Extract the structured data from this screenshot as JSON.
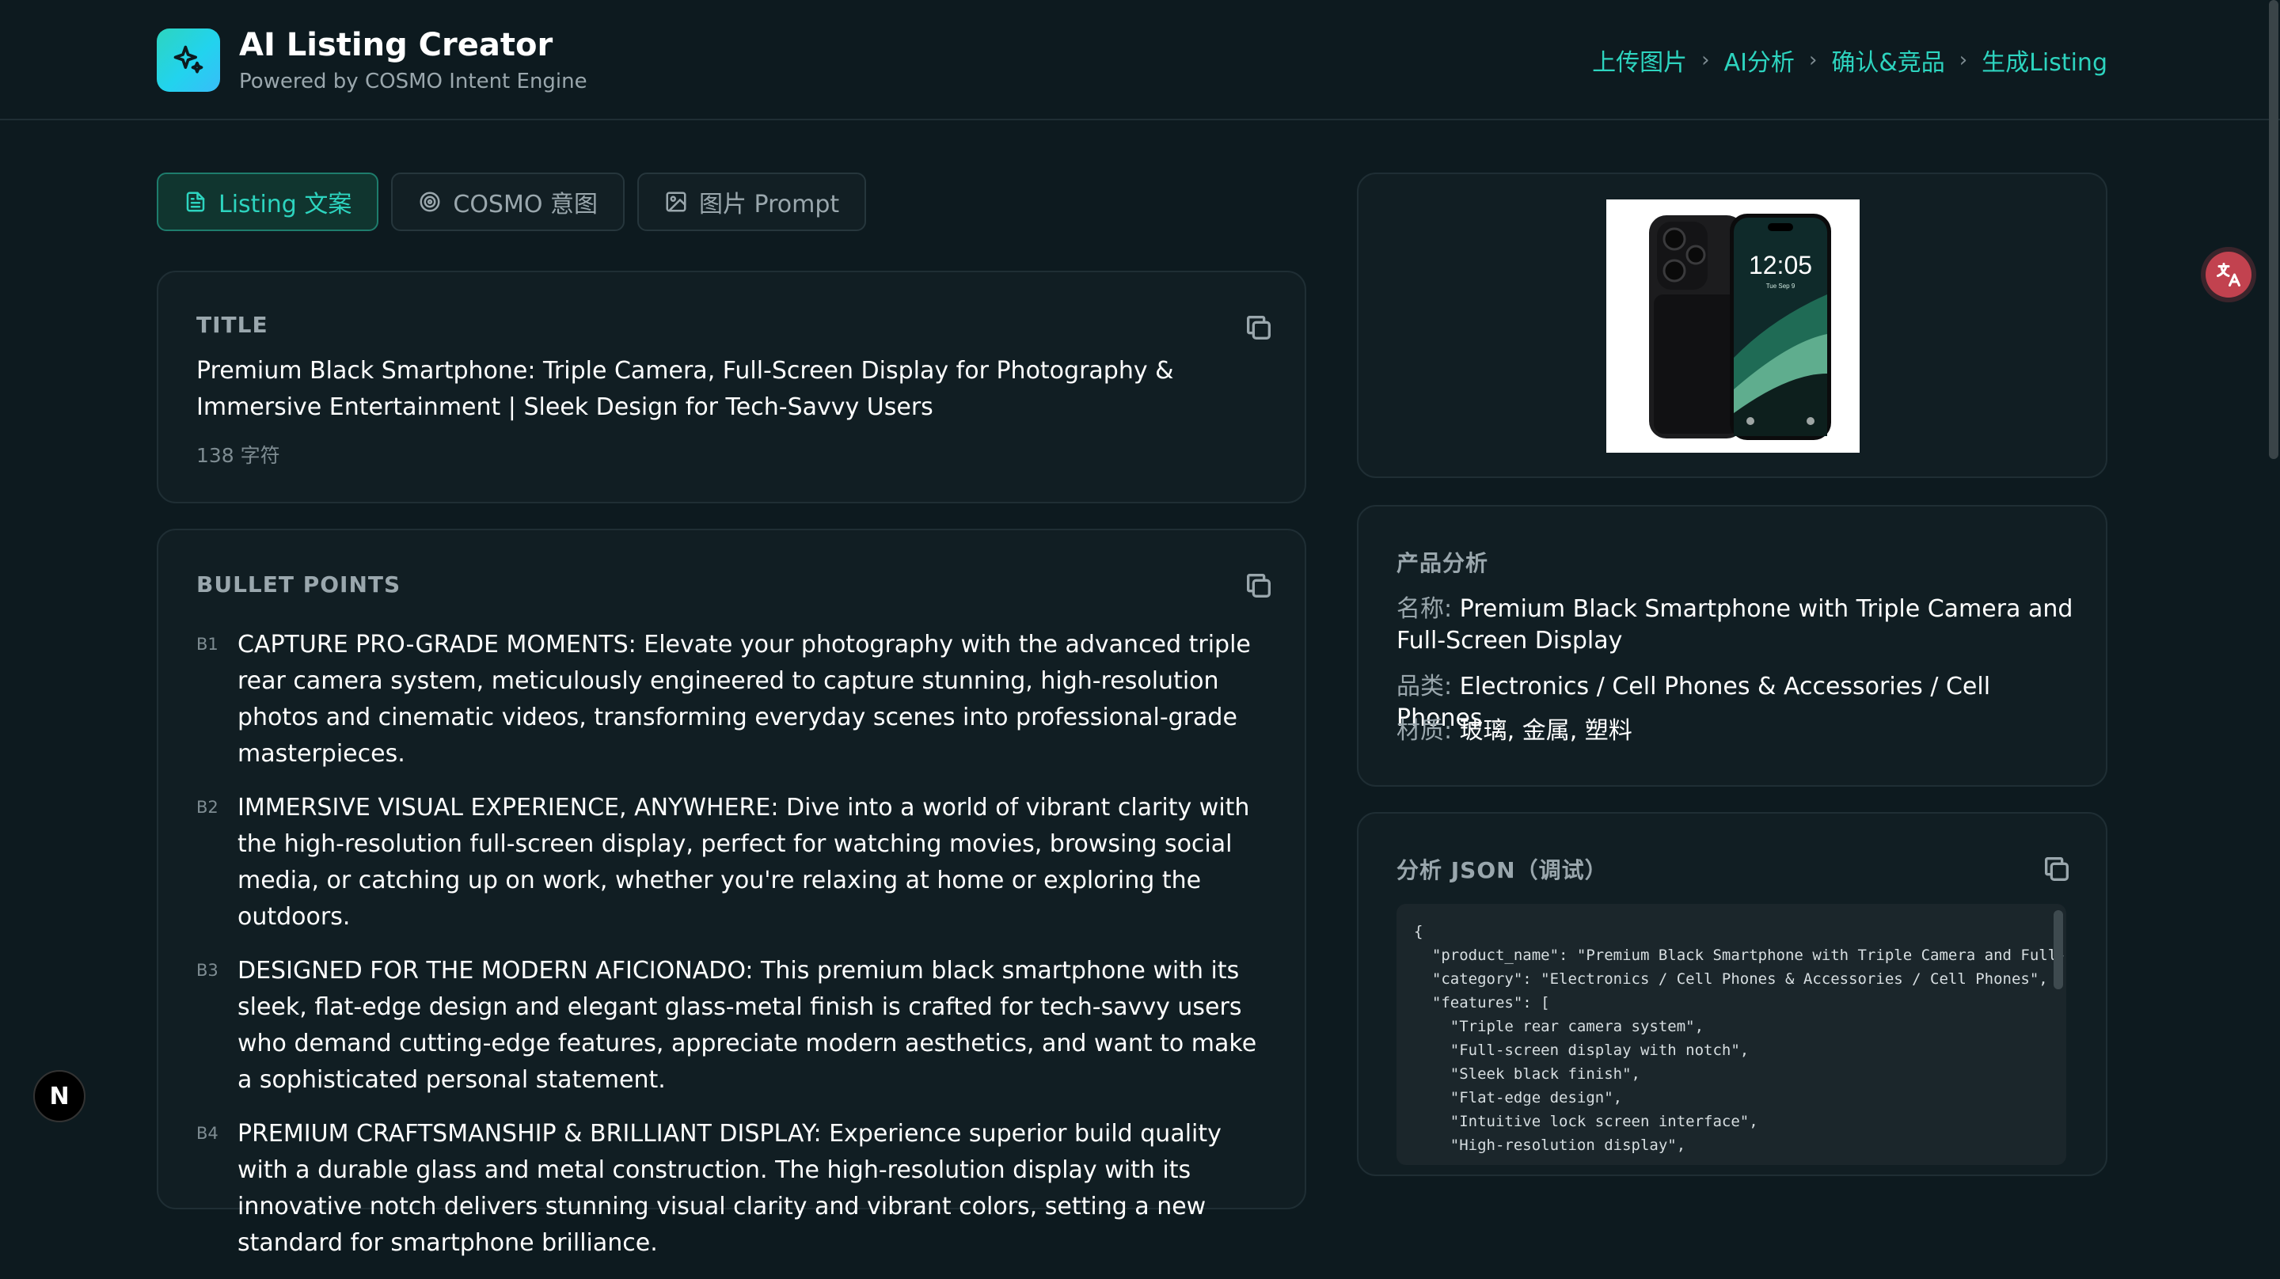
{
  "header": {
    "title": "AI Listing Creator",
    "subtitle": "Powered by COSMO Intent Engine",
    "steps": [
      "上传图片",
      "AI分析",
      "确认&竞品",
      "生成Listing"
    ]
  },
  "tabs": [
    {
      "label": "Listing 文案",
      "active": true
    },
    {
      "label": "COSMO 意图",
      "active": false
    },
    {
      "label": "图片 Prompt",
      "active": false
    }
  ],
  "title_card": {
    "label": "TITLE",
    "text": "Premium Black Smartphone: Triple Camera, Full-Screen Display for Photography & Immersive Entertainment | Sleek Design for Tech-Savvy Users",
    "char_count": "138 字符"
  },
  "bullets_card": {
    "label": "BULLET POINTS",
    "items": [
      {
        "tag": "B1",
        "text": "CAPTURE PRO-GRADE MOMENTS: Elevate your photography with the advanced triple rear camera system, meticulously engineered to capture stunning, high-resolution photos and cinematic videos, transforming everyday scenes into professional-grade masterpieces."
      },
      {
        "tag": "B2",
        "text": "IMMERSIVE VISUAL EXPERIENCE, ANYWHERE: Dive into a world of vibrant clarity with the high-resolution full-screen display, perfect for watching movies, browsing social media, or catching up on work, whether you're relaxing at home or exploring the outdoors."
      },
      {
        "tag": "B3",
        "text": "DESIGNED FOR THE MODERN AFICIONADO: This premium black smartphone with its sleek, flat-edge design and elegant glass-metal finish is crafted for tech-savvy users who demand cutting-edge features, appreciate modern aesthetics, and want to make a sophisticated personal statement."
      },
      {
        "tag": "B4",
        "text": "PREMIUM CRAFTSMANSHIP & BRILLIANT DISPLAY: Experience superior build quality with a durable glass and metal construction. The high-resolution display with its innovative notch delivers stunning visual clarity and vibrant colors, setting a new standard for smartphone brilliance."
      }
    ]
  },
  "product_image": {
    "clock": "12:05",
    "date": "Tue Sep 9"
  },
  "analysis_card": {
    "label": "产品分析",
    "name_key": "名称:",
    "name_value": "Premium Black Smartphone with Triple Camera and Full-Screen Display",
    "category_key": "品类:",
    "category_value": "Electronics / Cell Phones & Accessories / Cell Phones",
    "material_key": "材质:",
    "material_value": "玻璃, 金属, 塑料"
  },
  "json_card": {
    "label": "分析 JSON（调试）",
    "content": "{\n  \"product_name\": \"Premium Black Smartphone with Triple Camera and Full-S\n  \"category\": \"Electronics / Cell Phones & Accessories / Cell Phones\",\n  \"features\": [\n    \"Triple rear camera system\",\n    \"Full-screen display with notch\",\n    \"Sleek black finish\",\n    \"Flat-edge design\",\n    \"Intuitive lock screen interface\",\n    \"High-resolution display\","
  },
  "next_badge": "N",
  "colors": {
    "accent": "#2dd4bf",
    "background": "#0d1a1f",
    "card": "#111e23",
    "translate_button": "#c2424f"
  }
}
